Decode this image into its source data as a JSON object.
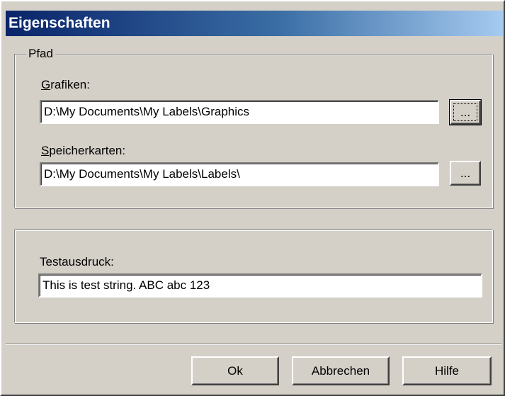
{
  "window": {
    "title": "Eigenschaften"
  },
  "path_group": {
    "legend": "Pfad",
    "graphics": {
      "label_accel": "G",
      "label_rest": "rafiken:",
      "value": "D:\\My Documents\\My Labels\\Graphics",
      "browse_label": "..."
    },
    "labels": {
      "label_accel": "S",
      "label_rest": "peicherkarten:",
      "value": "D:\\My Documents\\My Labels\\Labels\\",
      "browse_label": "..."
    }
  },
  "test_group": {
    "label": "Testausdruck:",
    "value": "This is test string. ABC abc 123"
  },
  "buttons": {
    "ok": "Ok",
    "cancel": "Abbrechen",
    "help": "Hilfe"
  }
}
